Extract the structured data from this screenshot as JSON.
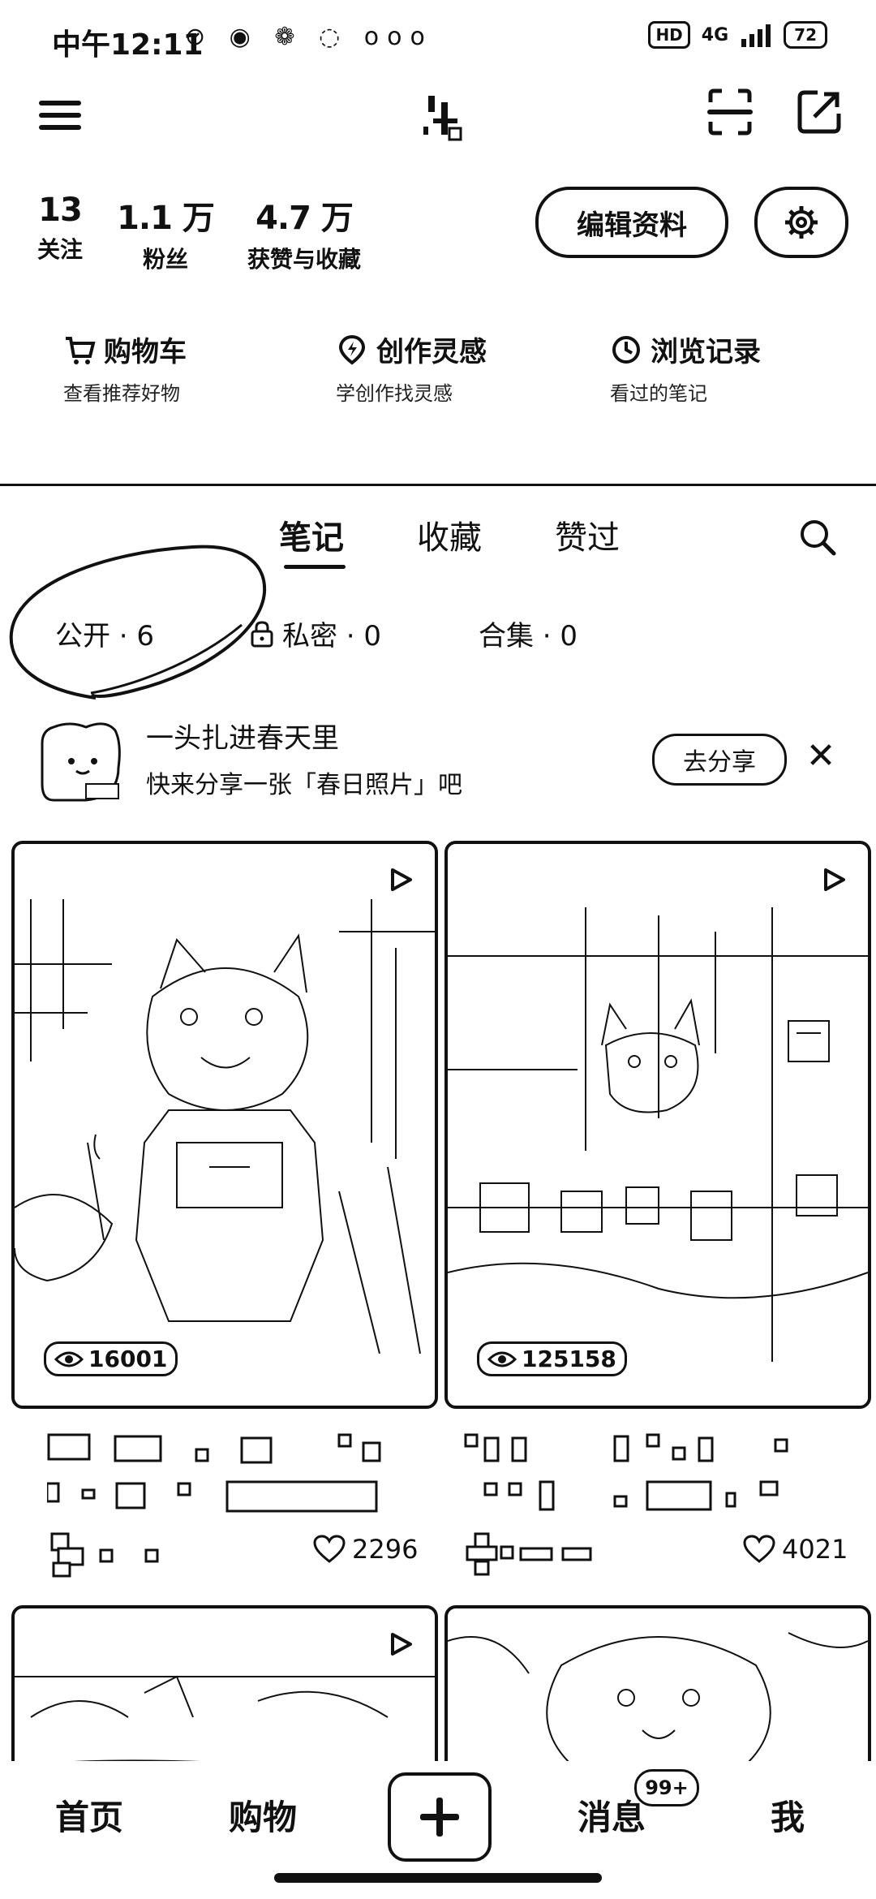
{
  "status_bar": {
    "time": "中午12:11",
    "left_icons": "⊘ ◉ ❁ ◌ ooo",
    "hd": "HD",
    "network": "4G",
    "battery": "72"
  },
  "profile": {
    "stats": [
      {
        "num": "13",
        "label": "关注"
      },
      {
        "num": "1.1 万",
        "label": "粉丝"
      },
      {
        "num": "4.7 万",
        "label": "获赞与收藏"
      }
    ],
    "edit_label": "编辑资料"
  },
  "quick_links": [
    {
      "title": "购物车",
      "sub": "查看推荐好物",
      "icon": "cart-icon"
    },
    {
      "title": "创作灵感",
      "sub": "学创作找灵感",
      "icon": "bulb-icon"
    },
    {
      "title": "浏览记录",
      "sub": "看过的笔记",
      "icon": "clock-icon"
    }
  ],
  "tabs": [
    {
      "label": "笔记",
      "active": true
    },
    {
      "label": "收藏",
      "active": false
    },
    {
      "label": "赞过",
      "active": false
    }
  ],
  "subtabs": [
    {
      "label": "公开 · 6"
    },
    {
      "label": "私密 · 0"
    },
    {
      "label": "合集 · 0"
    }
  ],
  "banner": {
    "title": "一头扎进春天里",
    "sub": "快来分享一张「春日照片」吧",
    "button": "去分享",
    "close": "✕"
  },
  "notes": [
    {
      "views": "16001",
      "likes": "2296"
    },
    {
      "views": "125158",
      "likes": "4021"
    }
  ],
  "bottom_nav": {
    "items": [
      "首页",
      "购物",
      "消息",
      "我"
    ],
    "badge": "99+"
  },
  "colors": {
    "ink": "#111111",
    "bg": "#ffffff"
  }
}
